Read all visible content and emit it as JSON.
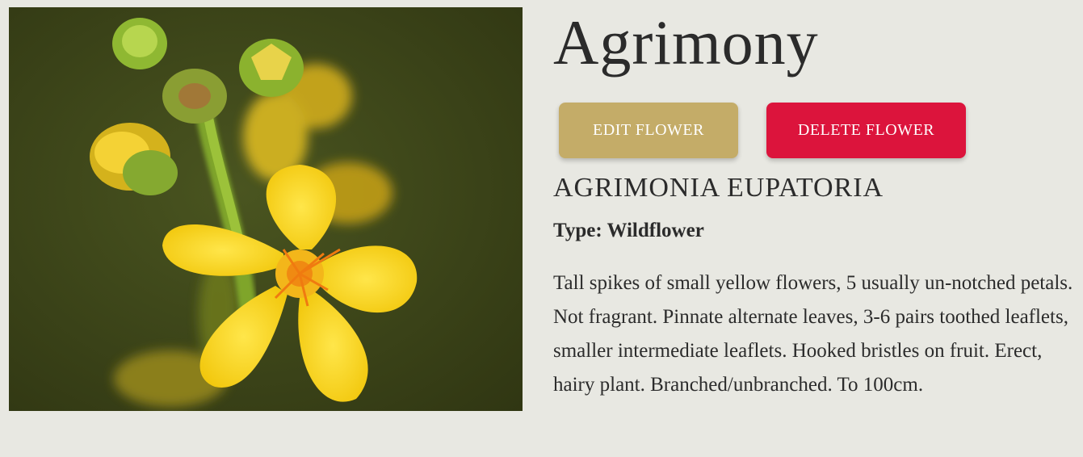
{
  "flower": {
    "name": "Agrimony",
    "scientific_name": "AGRIMONIA EUPATORIA",
    "type_label": "Type: Wildflower",
    "description": "Tall spikes of small yellow flowers, 5 usually un-notched petals. Not fragrant. Pinnate alternate leaves, 3-6 pairs toothed leaflets, smaller intermediate leaflets. Hooked bristles on fruit. Erect, hairy plant. Branched/unbranched. To 100cm."
  },
  "actions": {
    "edit_label": "EDIT FLOWER",
    "delete_label": "DELETE FLOWER"
  },
  "colors": {
    "background": "#e8e8e2",
    "edit_button": "#c4ac68",
    "delete_button": "#dc143c",
    "text": "#2b2b2b"
  },
  "image": {
    "subject": "yellow agrimony flower photo"
  }
}
